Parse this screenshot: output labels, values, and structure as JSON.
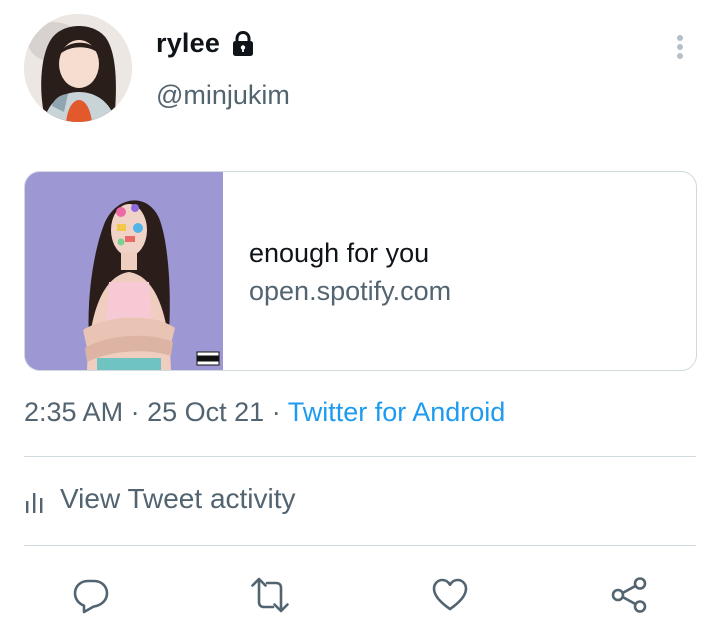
{
  "user": {
    "display_name": "rylee",
    "handle": "@minjukim",
    "protected_icon": "lock-icon",
    "avatar": "profile-photo"
  },
  "card": {
    "title": "enough for you",
    "domain": "open.spotify.com",
    "image": "album-cover",
    "image_badge": "PARENTAL ADVISORY EXPLICIT CONTENT"
  },
  "meta": {
    "time": "2:35 AM",
    "date": "25 Oct 21",
    "separator": "·",
    "source": "Twitter for Android"
  },
  "activity": {
    "label": "View Tweet activity",
    "icon": "bar-chart-icon"
  },
  "actions": [
    {
      "name": "reply",
      "icon": "reply-icon"
    },
    {
      "name": "retweet",
      "icon": "retweet-icon"
    },
    {
      "name": "like",
      "icon": "heart-icon"
    },
    {
      "name": "share",
      "icon": "share-icon"
    }
  ],
  "colors": {
    "link": "#1d9bf0",
    "secondary_text": "#536471",
    "primary_text": "#0f1419",
    "border": "#cfd9de",
    "album_background": "#9d97d3"
  }
}
